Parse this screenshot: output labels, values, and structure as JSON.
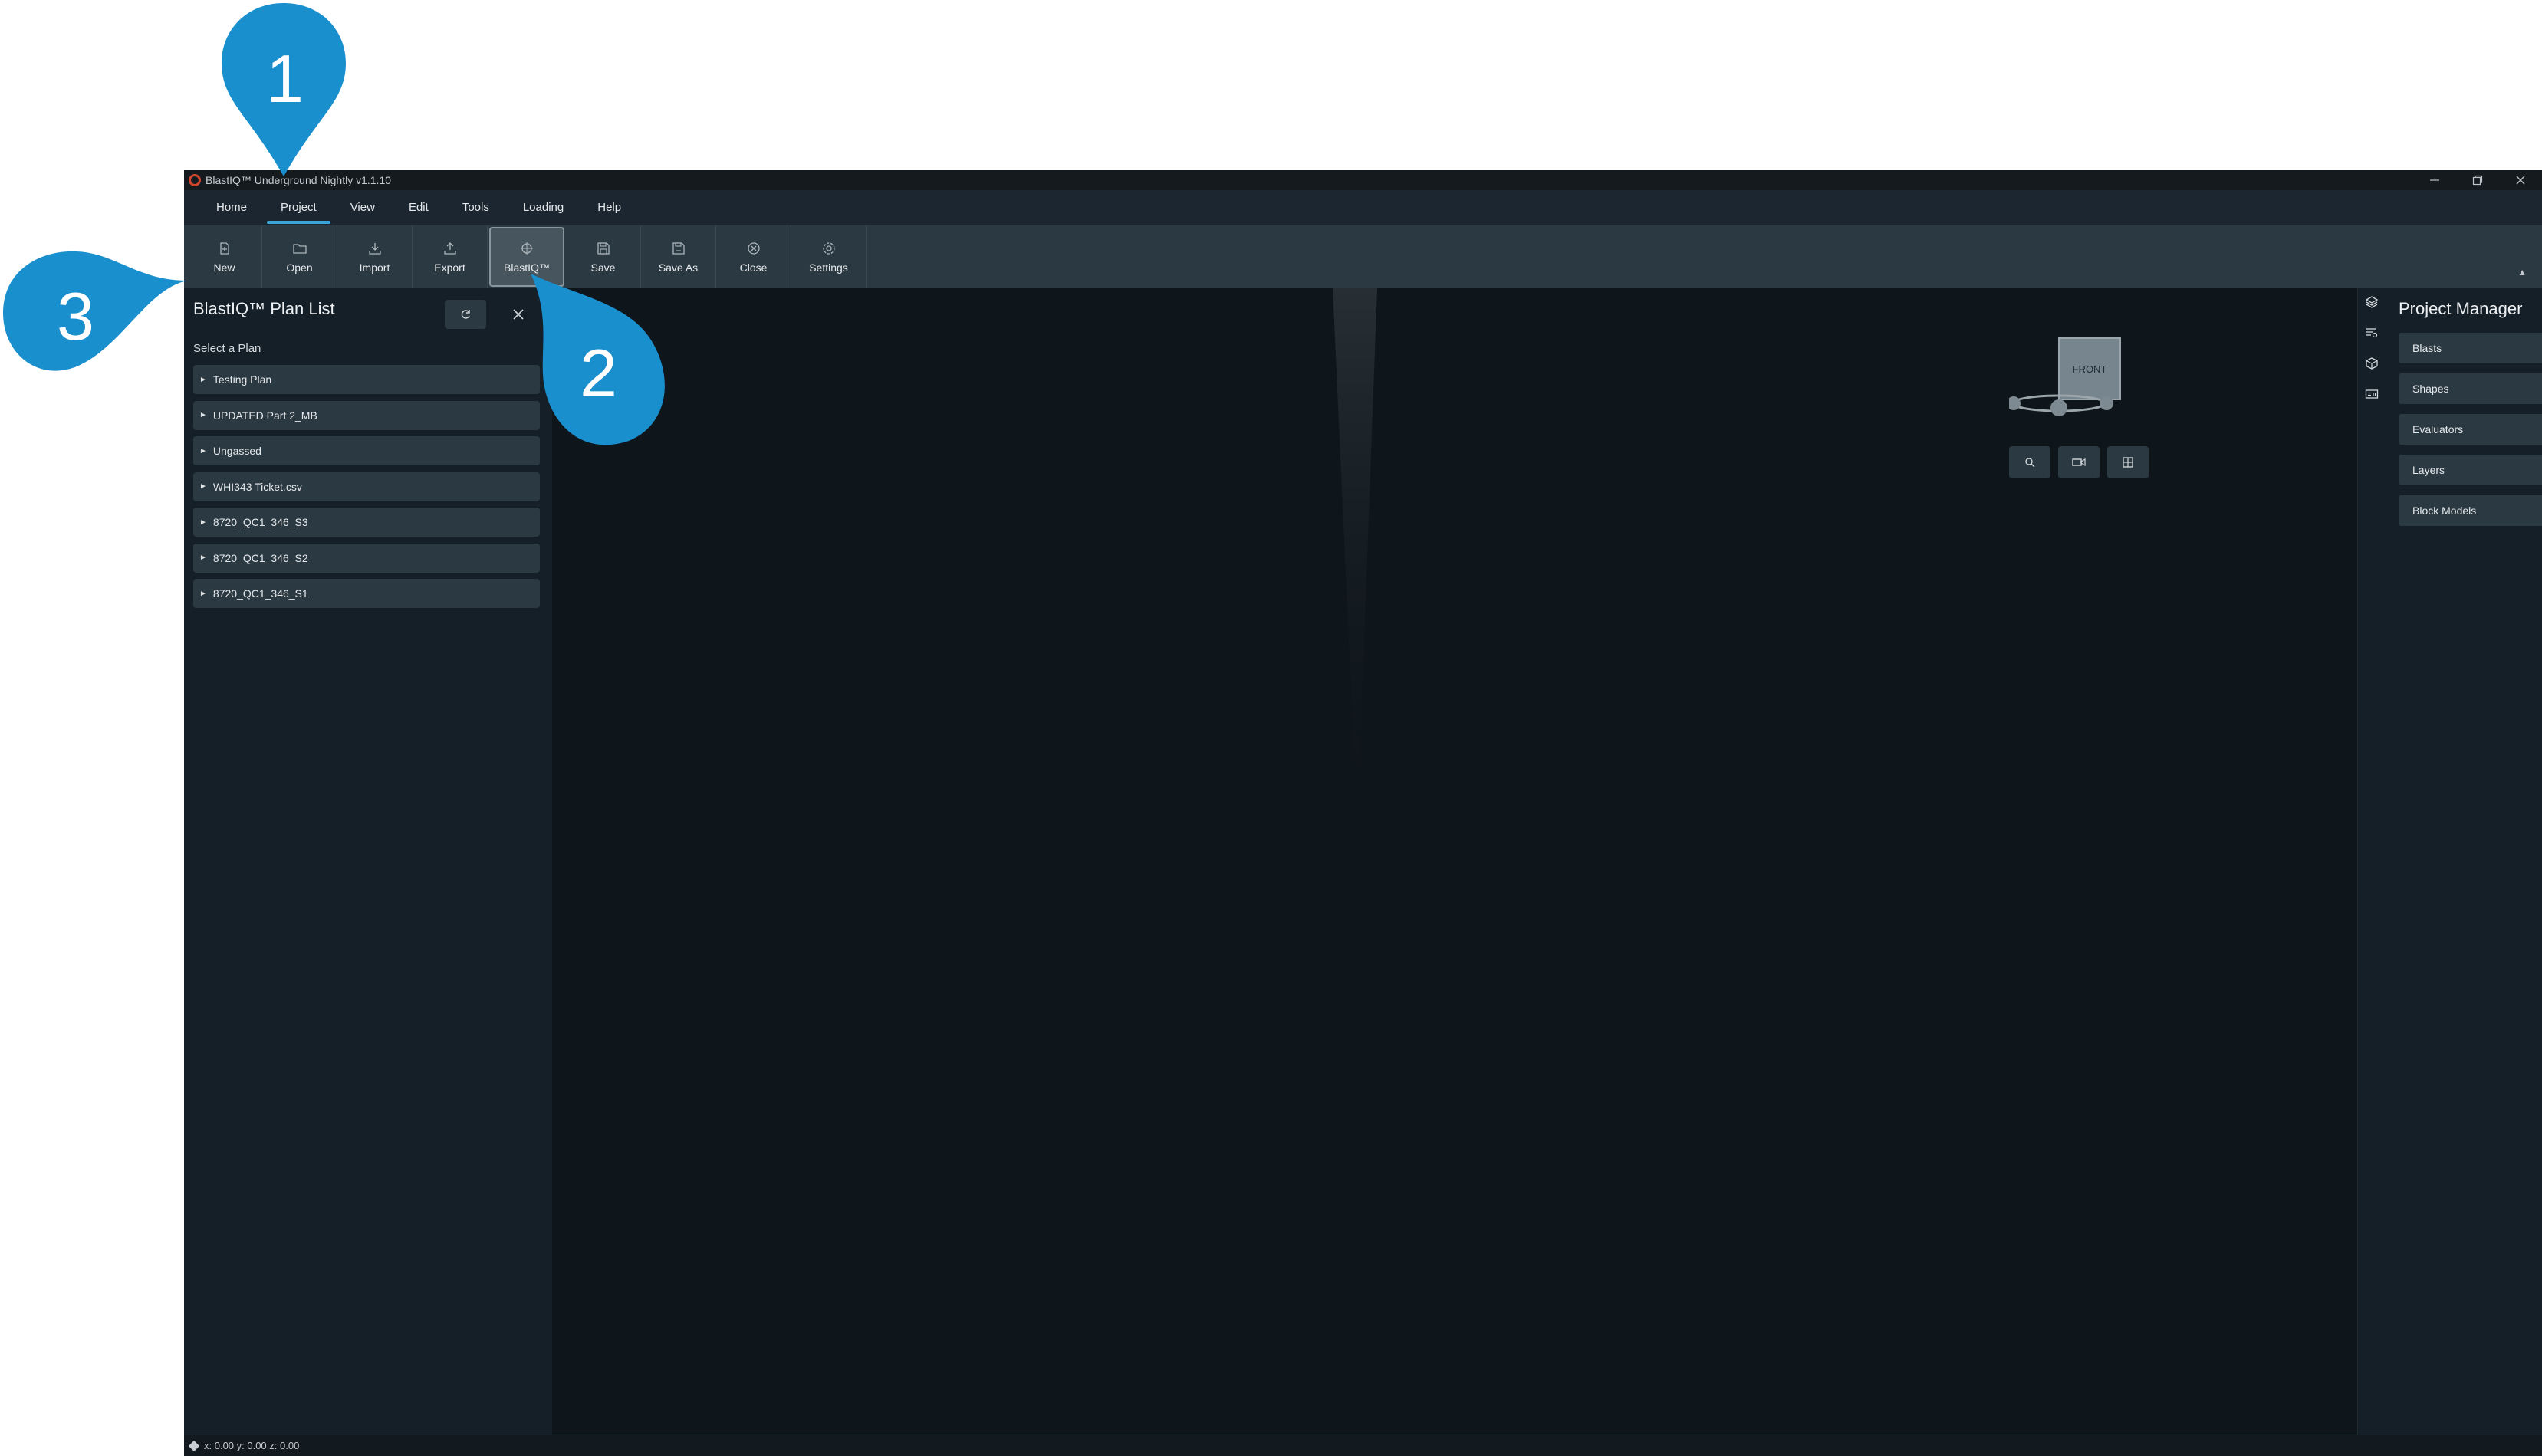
{
  "window": {
    "title": "BlastIQ™ Underground Nightly v1.1.10",
    "controls": [
      "minimize",
      "restore",
      "close"
    ]
  },
  "menu": [
    {
      "label": "Home"
    },
    {
      "label": "Project",
      "active": true
    },
    {
      "label": "View"
    },
    {
      "label": "Edit"
    },
    {
      "label": "Tools"
    },
    {
      "label": "Loading"
    },
    {
      "label": "Help"
    }
  ],
  "toolbar": [
    {
      "label": "New",
      "icon": "new-file-icon"
    },
    {
      "label": "Open",
      "icon": "folder-open-icon"
    },
    {
      "label": "Import",
      "icon": "import-icon"
    },
    {
      "label": "Export",
      "icon": "export-icon"
    },
    {
      "label": "BlastIQ™",
      "icon": "blastiq-icon",
      "active": true
    },
    {
      "label": "Save",
      "icon": "save-icon"
    },
    {
      "label": "Save As",
      "icon": "save-as-icon"
    },
    {
      "label": "Close",
      "icon": "close-circle-icon"
    },
    {
      "label": "Settings",
      "icon": "gear-icon"
    }
  ],
  "plan_list": {
    "title": "BlastIQ™ Plan List",
    "subtitle": "Select a Plan",
    "items": [
      "Testing Plan",
      "UPDATED Part 2_MB",
      "Ungassed",
      "WHI343 Ticket.csv",
      "8720_QC1_346_S3",
      "8720_QC1_346_S2",
      "8720_QC1_346_S1"
    ]
  },
  "viewport": {
    "cube_label": "FRONT",
    "tools": [
      "search-icon",
      "camera-icon",
      "grid-icon"
    ]
  },
  "side_strip": [
    "layers-icon",
    "filter-list-icon",
    "cube-icon",
    "id-card-icon"
  ],
  "project_manager": {
    "title": "Project Manager",
    "sections": [
      {
        "label": "Blasts",
        "expanded": true
      },
      {
        "label": "Shapes",
        "expanded": false
      },
      {
        "label": "Evaluators",
        "expanded": false
      },
      {
        "label": "Layers",
        "expanded": false
      },
      {
        "label": "Block Models",
        "expanded": false
      }
    ]
  },
  "status": {
    "coords": "x: 0.00 y: 0.00 z: 0.00"
  },
  "callouts": [
    "1",
    "2",
    "3"
  ],
  "colors": {
    "accent": "#3aa5d6",
    "callout": "#1a8fce",
    "panel": "#141f28",
    "toolbar": "#2b3942",
    "viewport": "#0f161b"
  }
}
